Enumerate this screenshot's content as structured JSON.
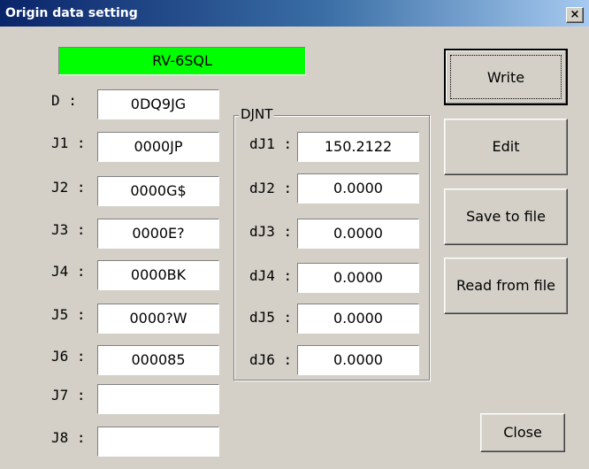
{
  "window": {
    "title": "Origin data setting",
    "close_glyph": "×"
  },
  "model": {
    "name": "RV-6SQL",
    "color": "#00ff00"
  },
  "origin_fields": [
    {
      "label": "D :",
      "value": "0DQ9JG"
    },
    {
      "label": "J1 :",
      "value": "0000JP"
    },
    {
      "label": "J2 :",
      "value": "0000G$"
    },
    {
      "label": "J3 :",
      "value": "0000E?"
    },
    {
      "label": "J4 :",
      "value": "0000BK"
    },
    {
      "label": "J5 :",
      "value": "0000?W"
    },
    {
      "label": "J6 :",
      "value": "000085"
    },
    {
      "label": "J7 :",
      "value": ""
    },
    {
      "label": "J8 :",
      "value": ""
    }
  ],
  "djnt": {
    "title": "DJNT",
    "fields": [
      {
        "label": "dJ1 :",
        "value": "150.2122"
      },
      {
        "label": "dJ2 :",
        "value": "0.0000"
      },
      {
        "label": "dJ3 :",
        "value": "0.0000"
      },
      {
        "label": "dJ4 :",
        "value": "0.0000"
      },
      {
        "label": "dJ5 :",
        "value": "0.0000"
      },
      {
        "label": "dJ6 :",
        "value": "0.0000"
      }
    ]
  },
  "buttons": {
    "write": "Write",
    "edit": "Edit",
    "save": "Save to file",
    "read": "Read from file",
    "close": "Close"
  }
}
